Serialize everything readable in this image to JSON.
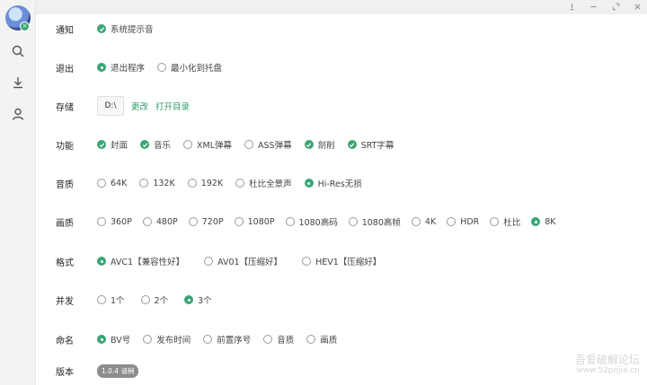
{
  "colors": {
    "accent": "#3aa675",
    "link": "#2e9c6a",
    "sidebar_bg": "#f3f3f3"
  },
  "sidebar": {
    "icons": [
      "avatar",
      "search-icon",
      "download-icon",
      "user-icon"
    ]
  },
  "window_controls": [
    "pin-icon",
    "minimize-icon",
    "maximize-icon",
    "close-icon"
  ],
  "settings": {
    "notify": {
      "label": "通知",
      "options": [
        {
          "text": "系统提示音",
          "type": "check",
          "checked": true
        }
      ]
    },
    "exit": {
      "label": "退出",
      "options": [
        {
          "text": "退出程序",
          "type": "radio",
          "checked": true
        },
        {
          "text": "最小化到托盘",
          "type": "radio",
          "checked": false
        }
      ]
    },
    "storage": {
      "label": "存储",
      "path": "D:\\",
      "change": "更改",
      "open_dir": "打开目录"
    },
    "features": {
      "label": "功能",
      "options": [
        {
          "text": "封面",
          "type": "check",
          "checked": true
        },
        {
          "text": "音乐",
          "type": "check",
          "checked": true
        },
        {
          "text": "XML弹幕",
          "type": "radio",
          "checked": false
        },
        {
          "text": "ASS弹幕",
          "type": "radio",
          "checked": false
        },
        {
          "text": "剖削",
          "type": "check",
          "checked": true
        },
        {
          "text": "SRT字幕",
          "type": "check",
          "checked": true
        }
      ]
    },
    "audio": {
      "label": "音质",
      "options": [
        {
          "text": "64K",
          "checked": false
        },
        {
          "text": "132K",
          "checked": false
        },
        {
          "text": "192K",
          "checked": false
        },
        {
          "text": "杜比全景声",
          "checked": false
        },
        {
          "text": "Hi-Res无损",
          "checked": true
        }
      ]
    },
    "video": {
      "label": "画质",
      "options": [
        {
          "text": "360P",
          "checked": false
        },
        {
          "text": "480P",
          "checked": false
        },
        {
          "text": "720P",
          "checked": false
        },
        {
          "text": "1080P",
          "checked": false
        },
        {
          "text": "1080高码",
          "checked": false
        },
        {
          "text": "1080高帧",
          "checked": false
        },
        {
          "text": "4K",
          "checked": false
        },
        {
          "text": "HDR",
          "checked": false
        },
        {
          "text": "杜比",
          "checked": false
        },
        {
          "text": "8K",
          "checked": true
        }
      ]
    },
    "format": {
      "label": "格式",
      "options": [
        {
          "text": "AVC1【兼容性好】",
          "checked": true
        },
        {
          "text": "AV01【压缩好】",
          "checked": false
        },
        {
          "text": "HEV1【压缩好】",
          "checked": false
        }
      ]
    },
    "concurrency": {
      "label": "并发",
      "options": [
        {
          "text": "1个",
          "checked": false
        },
        {
          "text": "2个",
          "checked": false
        },
        {
          "text": "3个",
          "checked": true
        }
      ]
    },
    "naming": {
      "label": "命名",
      "options": [
        {
          "text": "BV号",
          "checked": true
        },
        {
          "text": "发布时间",
          "checked": false
        },
        {
          "text": "前置序号",
          "checked": false
        },
        {
          "text": "音质",
          "checked": false
        },
        {
          "text": "画质",
          "checked": false
        }
      ]
    },
    "version": {
      "label": "版本",
      "value": "1.0.4 请稍"
    }
  },
  "watermark": {
    "line1": "吾爱破解论坛",
    "line2": "www.52pojie.cn"
  }
}
